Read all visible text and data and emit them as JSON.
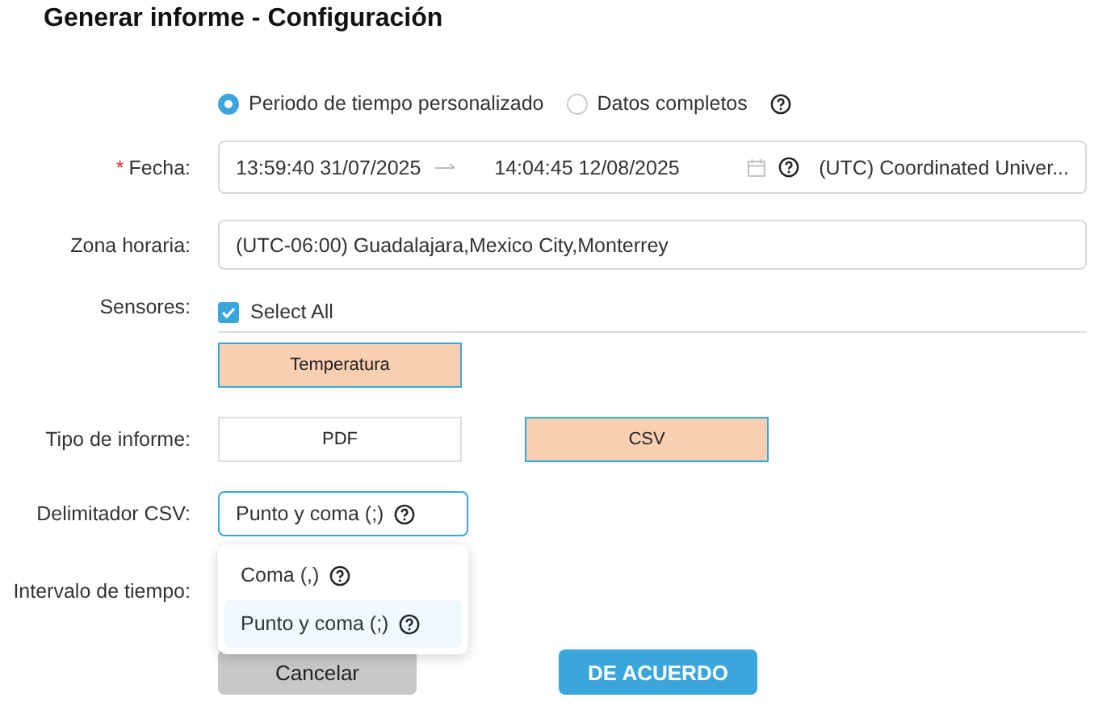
{
  "title": "Generar informe - Configuración",
  "range_options": [
    {
      "label": "Periodo de tiempo personalizado",
      "selected": true
    },
    {
      "label": "Datos completos",
      "selected": false
    }
  ],
  "date": {
    "required_mark": "*",
    "label": "Fecha:",
    "start": "13:59:40 31/07/2025",
    "end": "14:04:45 12/08/2025",
    "timezone": "(UTC) Coordinated Univer..."
  },
  "timezone": {
    "label": "Zona horaria:",
    "value": "(UTC-06:00) Guadalajara,Mexico City,Monterrey"
  },
  "sensors": {
    "label": "Sensores:",
    "select_all": {
      "label": "Select All",
      "checked": true
    },
    "items": [
      {
        "label": "Temperatura",
        "selected": true
      }
    ]
  },
  "report_type": {
    "label": "Tipo de informe:",
    "options": [
      {
        "label": "PDF",
        "selected": false
      },
      {
        "label": "CSV",
        "selected": true
      }
    ]
  },
  "delimiter": {
    "label": "Delimitador CSV:",
    "value": "Punto y coma (;)",
    "expanded": true,
    "options": [
      {
        "label": "Coma (,)",
        "selected": false
      },
      {
        "label": "Punto y coma (;)",
        "selected": true
      }
    ]
  },
  "interval": {
    "label": "Intervalo de tiempo:"
  },
  "buttons": [
    {
      "label": "Cancelar",
      "kind": "secondary"
    },
    {
      "label": "DE ACUERDO",
      "kind": "primary"
    }
  ]
}
